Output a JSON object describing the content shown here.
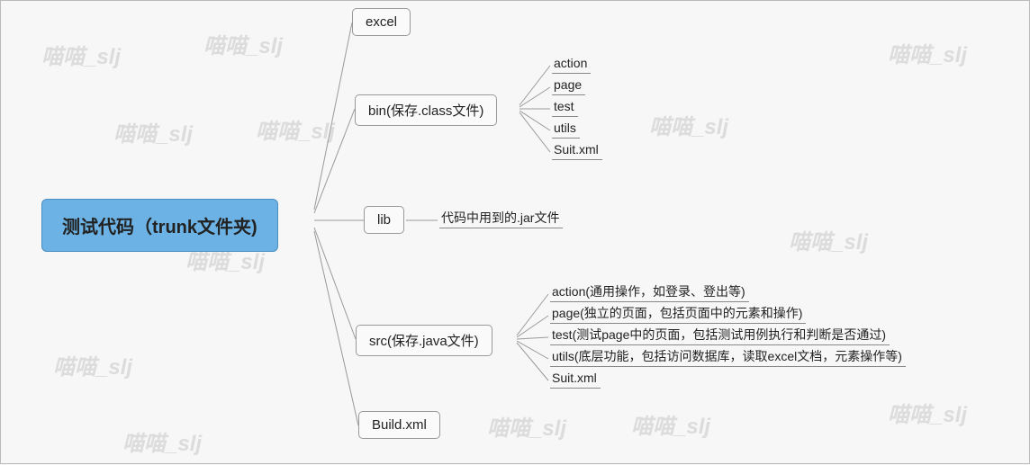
{
  "watermark_text": "喵喵_slj",
  "root": {
    "label": "测试代码（trunk文件夹)"
  },
  "branches": {
    "excel": {
      "label": "excel"
    },
    "bin": {
      "label": "bin(保存.class文件)",
      "children": {
        "action": "action",
        "page": "page",
        "test": "test",
        "utils": "utils",
        "suit": "Suit.xml"
      }
    },
    "lib": {
      "label": "lib",
      "children": {
        "desc": "代码中用到的.jar文件"
      }
    },
    "src": {
      "label": "src(保存.java文件)",
      "children": {
        "action": "action(通用操作，如登录、登出等)",
        "page": "page(独立的页面，包括页面中的元素和操作)",
        "test": "test(测试page中的页面，包括测试用例执行和判断是否通过)",
        "utils": "utils(底层功能，包括访问数据库，读取excel文档，元素操作等)",
        "suit": "Suit.xml"
      }
    },
    "build": {
      "label": "Build.xml"
    }
  }
}
